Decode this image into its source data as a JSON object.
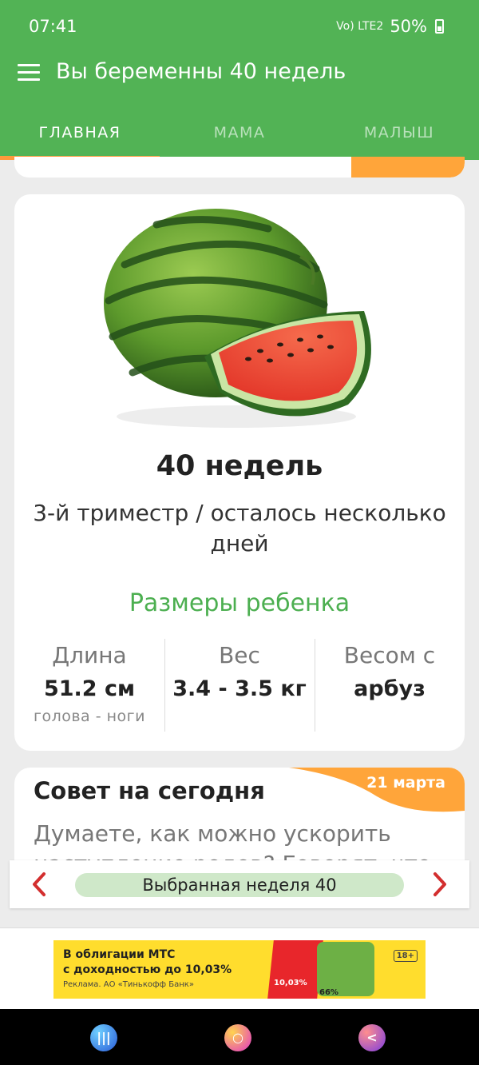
{
  "status_bar": {
    "time": "07:41",
    "network": "Vo) LTE2",
    "battery": "50%"
  },
  "app_bar": {
    "title": "Вы беременны 40 недель",
    "menu_icon": "hamburger-menu-icon"
  },
  "tabs": [
    {
      "label": "ГЛАВНАЯ",
      "active": true
    },
    {
      "label": "МАМА",
      "active": false
    },
    {
      "label": "МАЛЫШ",
      "active": false
    }
  ],
  "week_card": {
    "fruit_image": "watermelon",
    "weeks": "40 недель",
    "trimester": "3-й триместр / осталось несколько дней",
    "sizes_title": "Размеры ребенка",
    "sizes": [
      {
        "label": "Длина",
        "value": "51.2 см",
        "sub": "голова - ноги"
      },
      {
        "label": "Вес",
        "value": "3.4 - 3.5 кг",
        "sub": ""
      },
      {
        "label": "Весом с",
        "value": "арбуз",
        "sub": ""
      }
    ]
  },
  "advice_card": {
    "title": "Совет на сегодня",
    "date": "21 марта",
    "text": "Думаете, как можно ускорить наступление родов? Говорят, что"
  },
  "week_nav": {
    "label": "Выбранная неделя 40",
    "prev_icon": "chevron-left-icon",
    "next_icon": "chevron-right-icon"
  },
  "ad": {
    "line1": "В облигации МТС",
    "line2": "с доходностью до 10,03%",
    "line3": "Реклама. АО «Тинькофф Банк»",
    "rate": "10,03%",
    "rate2": "66%",
    "age": "18+"
  },
  "colors": {
    "primary": "#52b355",
    "accent": "#ff9a3c",
    "sizes_title": "#4caf50",
    "nav_arrow": "#d32f2f"
  }
}
